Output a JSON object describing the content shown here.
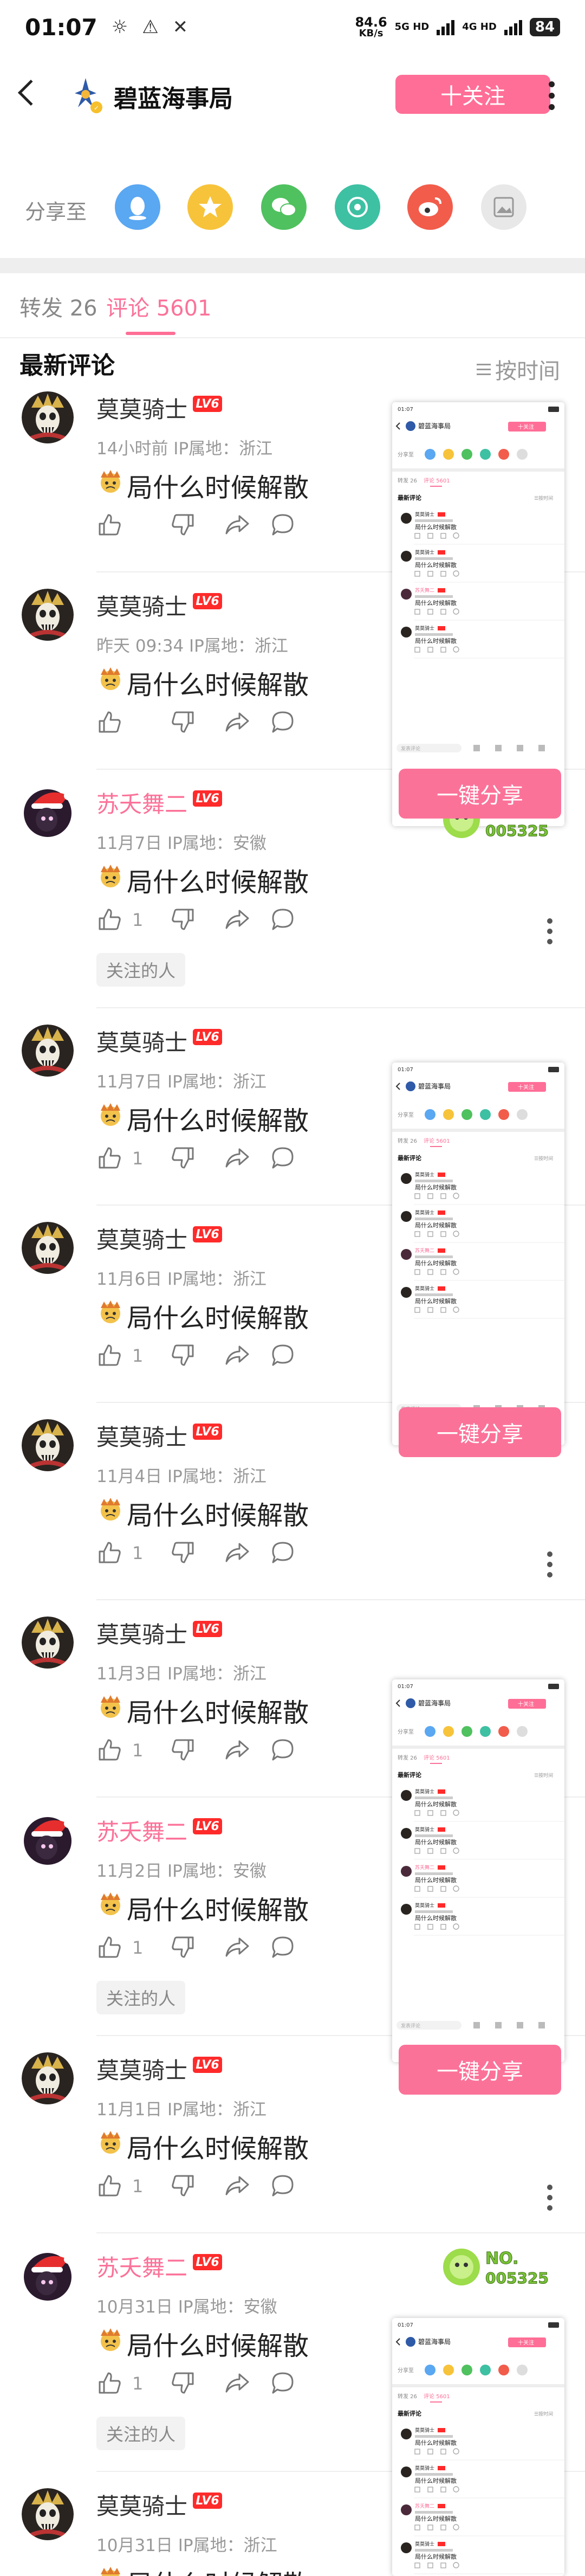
{
  "status_bar": {
    "time": "01:07",
    "glyph_icons": [
      "brightness-icon",
      "alert-icon",
      "tools-icon"
    ],
    "net_speed_value": "84.6",
    "net_speed_unit": "KB/s",
    "net_tags": [
      "5G HD",
      "4G HD"
    ],
    "battery": "84"
  },
  "header": {
    "title": "碧蓝海事局",
    "follow_label": "十关注"
  },
  "share": {
    "label": "分享至",
    "targets": [
      {
        "name": "qq",
        "color": "#5aa7f2"
      },
      {
        "name": "qzone",
        "color": "#f7c33a"
      },
      {
        "name": "wechat",
        "color": "#4fc15f"
      },
      {
        "name": "moments",
        "color": "#3ec0a3"
      },
      {
        "name": "weibo",
        "color": "#f25c4b"
      },
      {
        "name": "poster",
        "color": "#cccccc"
      }
    ]
  },
  "tabs": [
    {
      "label": "转发 26",
      "active": false
    },
    {
      "label": "评论 5601",
      "active": true
    }
  ],
  "section_title": "最新评论",
  "sort_label": "按时间",
  "comments": [
    {
      "user": "莫莫骑士",
      "level": "LV6",
      "meta": "14小时前  IP属地：浙江",
      "text": "局什么时候解散",
      "likes": "",
      "follow_tag": "",
      "pink": false,
      "kebab": false
    },
    {
      "user": "莫莫骑士",
      "level": "LV6",
      "meta": "昨天 09:34  IP属地：浙江",
      "text": "局什么时候解散",
      "likes": "",
      "follow_tag": "",
      "pink": false,
      "kebab": false
    },
    {
      "user": "苏夭舞二",
      "level": "LV6",
      "meta": "11月7日  IP属地：安徽",
      "text": "局什么时候解散",
      "likes": "1",
      "follow_tag": "关注的人",
      "pink": true,
      "kebab": true
    },
    {
      "user": "莫莫骑士",
      "level": "LV6",
      "meta": "11月7日  IP属地：浙江",
      "text": "局什么时候解散",
      "likes": "1",
      "follow_tag": "",
      "pink": false,
      "kebab": false
    },
    {
      "user": "莫莫骑士",
      "level": "LV6",
      "meta": "11月6日  IP属地：浙江",
      "text": "局什么时候解散",
      "likes": "1",
      "follow_tag": "",
      "pink": false,
      "kebab": false
    },
    {
      "user": "莫莫骑士",
      "level": "LV6",
      "meta": "11月4日  IP属地：浙江",
      "text": "局什么时候解散",
      "likes": "1",
      "follow_tag": "",
      "pink": false,
      "kebab": true
    },
    {
      "user": "莫莫骑士",
      "level": "LV6",
      "meta": "11月3日  IP属地：浙江",
      "text": "局什么时候解散",
      "likes": "1",
      "follow_tag": "",
      "pink": false,
      "kebab": false
    },
    {
      "user": "苏夭舞二",
      "level": "LV6",
      "meta": "11月2日  IP属地：安徽",
      "text": "局什么时候解散",
      "likes": "1",
      "follow_tag": "关注的人",
      "pink": true,
      "kebab": false
    },
    {
      "user": "莫莫骑士",
      "level": "LV6",
      "meta": "11月1日  IP属地：浙江",
      "text": "局什么时候解散",
      "likes": "1",
      "follow_tag": "",
      "pink": false,
      "kebab": true
    },
    {
      "user": "苏夭舞二",
      "level": "LV6",
      "meta": "10月31日  IP属地：安徽",
      "text": "局什么时候解散",
      "likes": "1",
      "follow_tag": "关注的人",
      "pink": true,
      "kebab": false
    },
    {
      "user": "莫莫骑士",
      "level": "LV6",
      "meta": "10月31日  IP属地：浙江",
      "text": "局什么时候解散",
      "likes": "",
      "follow_tag": "",
      "pink": false,
      "kebab": false
    }
  ],
  "overlay": {
    "share_button_label": "一键分享",
    "badge_text": "NO.\n005325",
    "preview": {
      "header_title": "碧蓝海事局",
      "follow_label": "十关注",
      "share_label": "分享至",
      "tab_forward": "转发 26",
      "tab_comment": "评论 5601",
      "section_title": "最新评论",
      "sort_label": "按时间",
      "comment_text": "局什么时候解散",
      "input_placeholder": "发表评论"
    }
  }
}
